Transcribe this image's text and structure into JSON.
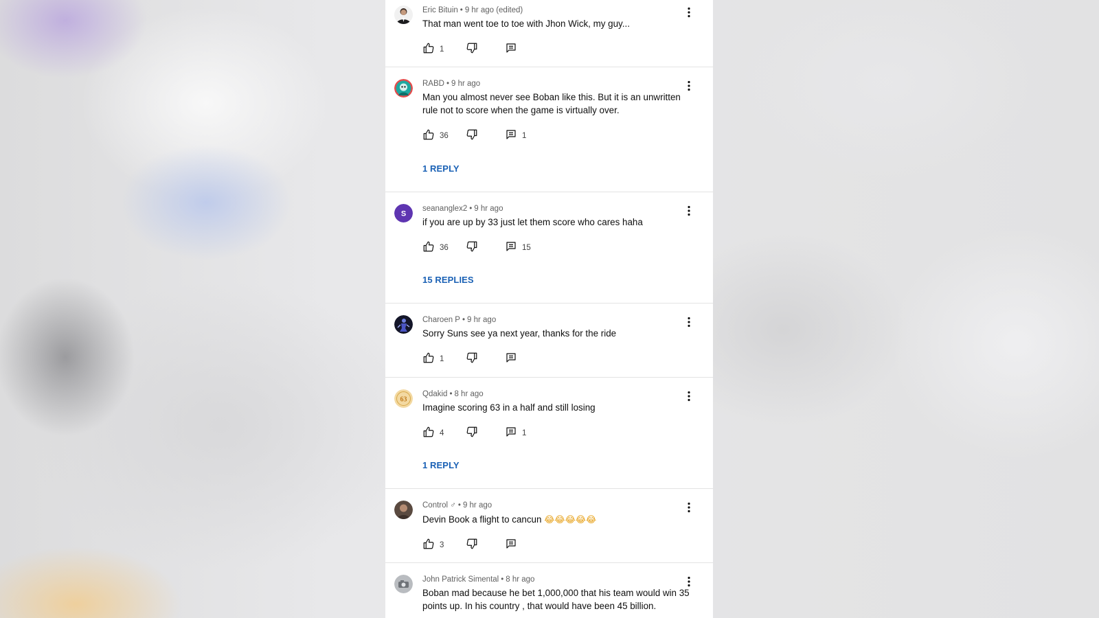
{
  "comments": [
    {
      "author": "Eric Bituin",
      "time": "9 hr ago (edited)",
      "text": "That man went toe to toe with Jhon Wick, my guy...",
      "likes": "1",
      "replies_count": "",
      "replies_link": "",
      "avatar_icon": "person-in-suit-avatar"
    },
    {
      "author": "RABD",
      "time": "9 hr ago",
      "text": "Man you almost never see Boban like this. But it is an unwritten rule not to score when the game is virtually over.",
      "likes": "36",
      "replies_count": "1",
      "replies_link": "1 REPLY",
      "avatar_icon": "teal-cartoon-avatar"
    },
    {
      "author": "seananglex2",
      "time": "9 hr ago",
      "text": "if you are up by 33 just let them score who cares haha",
      "likes": "36",
      "replies_count": "15",
      "replies_link": "15 REPLIES",
      "avatar_letter": "S",
      "avatar_color": "#5e35b1"
    },
    {
      "author": "Charoen P",
      "time": "9 hr ago",
      "text": "Sorry Suns see ya next year, thanks for the ride",
      "likes": "1",
      "replies_count": "",
      "replies_link": "",
      "avatar_icon": "dark-figure-avatar"
    },
    {
      "author": "Qdakid",
      "time": "8 hr ago",
      "text": "Imagine scoring 63 in a half and still losing",
      "likes": "4",
      "replies_count": "1",
      "replies_link": "1 REPLY",
      "avatar_icon": "gold-badge-avatar"
    },
    {
      "author": "Control ♂",
      "time": "9 hr ago",
      "text_main": "Devin Book a flight to cancun",
      "text_emoji": "😂😂😂😂😂",
      "likes": "3",
      "replies_count": "",
      "replies_link": "",
      "avatar_icon": "brown-portrait-avatar"
    },
    {
      "author": "John Patrick Simental",
      "time": "8 hr ago",
      "text": "Boban mad because he bet 1,000,000 that his team would win 35 points up. In his country , that would have been 45 billion.",
      "likes": "",
      "replies_count": "",
      "replies_link": "",
      "avatar_icon": "grey-photo-avatar"
    }
  ],
  "icons": {
    "like": "thumbs-up-icon",
    "dislike": "thumbs-down-icon",
    "reply": "comment-icon",
    "more": "more-vert-icon"
  },
  "colors": {
    "link": "#1a61b5",
    "meta": "#606060",
    "text": "#0f0f0f"
  }
}
